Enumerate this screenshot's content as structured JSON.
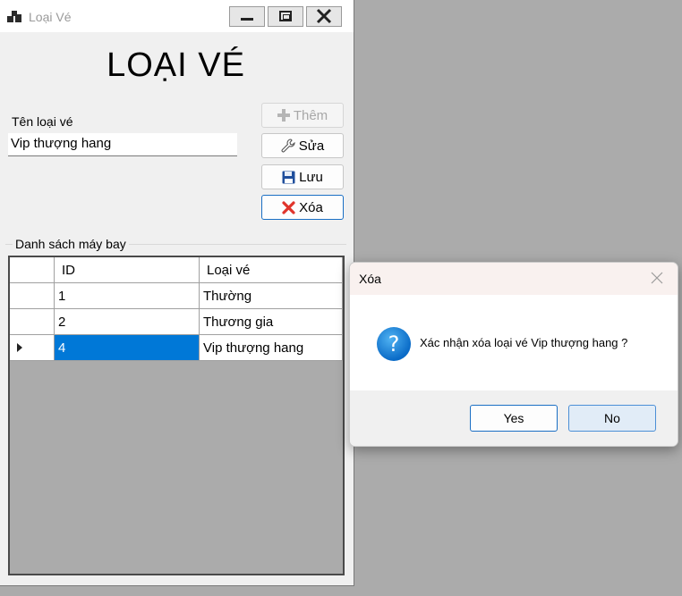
{
  "window": {
    "title": "Loại Vé",
    "heading": "LOẠI VÉ",
    "field_label": "Tên loại vé",
    "field_value": "Vip thượng hang",
    "buttons": {
      "add": "Thêm",
      "edit": "Sửa",
      "save": "Lưu",
      "delete": "Xóa"
    },
    "group_title": "Danh sách máy bay",
    "grid": {
      "columns": [
        "",
        "ID",
        "Loại vé"
      ],
      "rows": [
        {
          "id": "1",
          "type": "Thường",
          "selected": false
        },
        {
          "id": "2",
          "type": "Thương gia",
          "selected": false
        },
        {
          "id": "4",
          "type": "Vip thượng hang",
          "selected": true
        }
      ]
    }
  },
  "dialog": {
    "title": "Xóa",
    "icon": "question-icon",
    "message": "Xác nhận xóa loại vé Vip thượng hang ?",
    "yes": "Yes",
    "no": "No"
  },
  "colors": {
    "selection": "#0078d7",
    "desktop": "#ababab",
    "delete_icon": "#e0342b",
    "save_icon": "#1f4e9c"
  }
}
